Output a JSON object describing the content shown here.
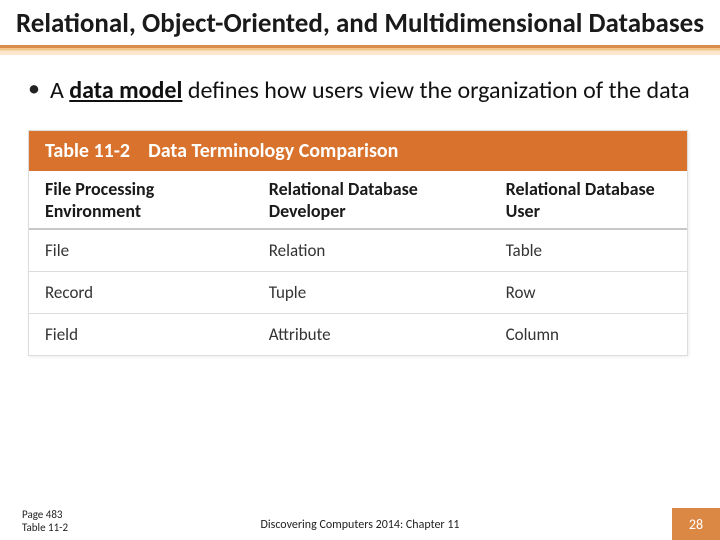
{
  "title": "Relational, Object-Oriented, and Multidimensional Databases",
  "bullet": {
    "prefix": "A ",
    "term": "data model",
    "rest": " defines how users view the organization of the data"
  },
  "table": {
    "number": "Table 11-2",
    "title": "Data Terminology Comparison",
    "columns": [
      "File Processing Environment",
      "Relational Database Developer",
      "Relational Database User"
    ],
    "rows": [
      [
        "File",
        "Relation",
        "Table"
      ],
      [
        "Record",
        "Tuple",
        "Row"
      ],
      [
        "Field",
        "Attribute",
        "Column"
      ]
    ]
  },
  "footer": {
    "page_ref": "Page 483",
    "table_ref": "Table 11-2",
    "center": "Discovering Computers 2014: Chapter 11",
    "slide_number": "28"
  }
}
